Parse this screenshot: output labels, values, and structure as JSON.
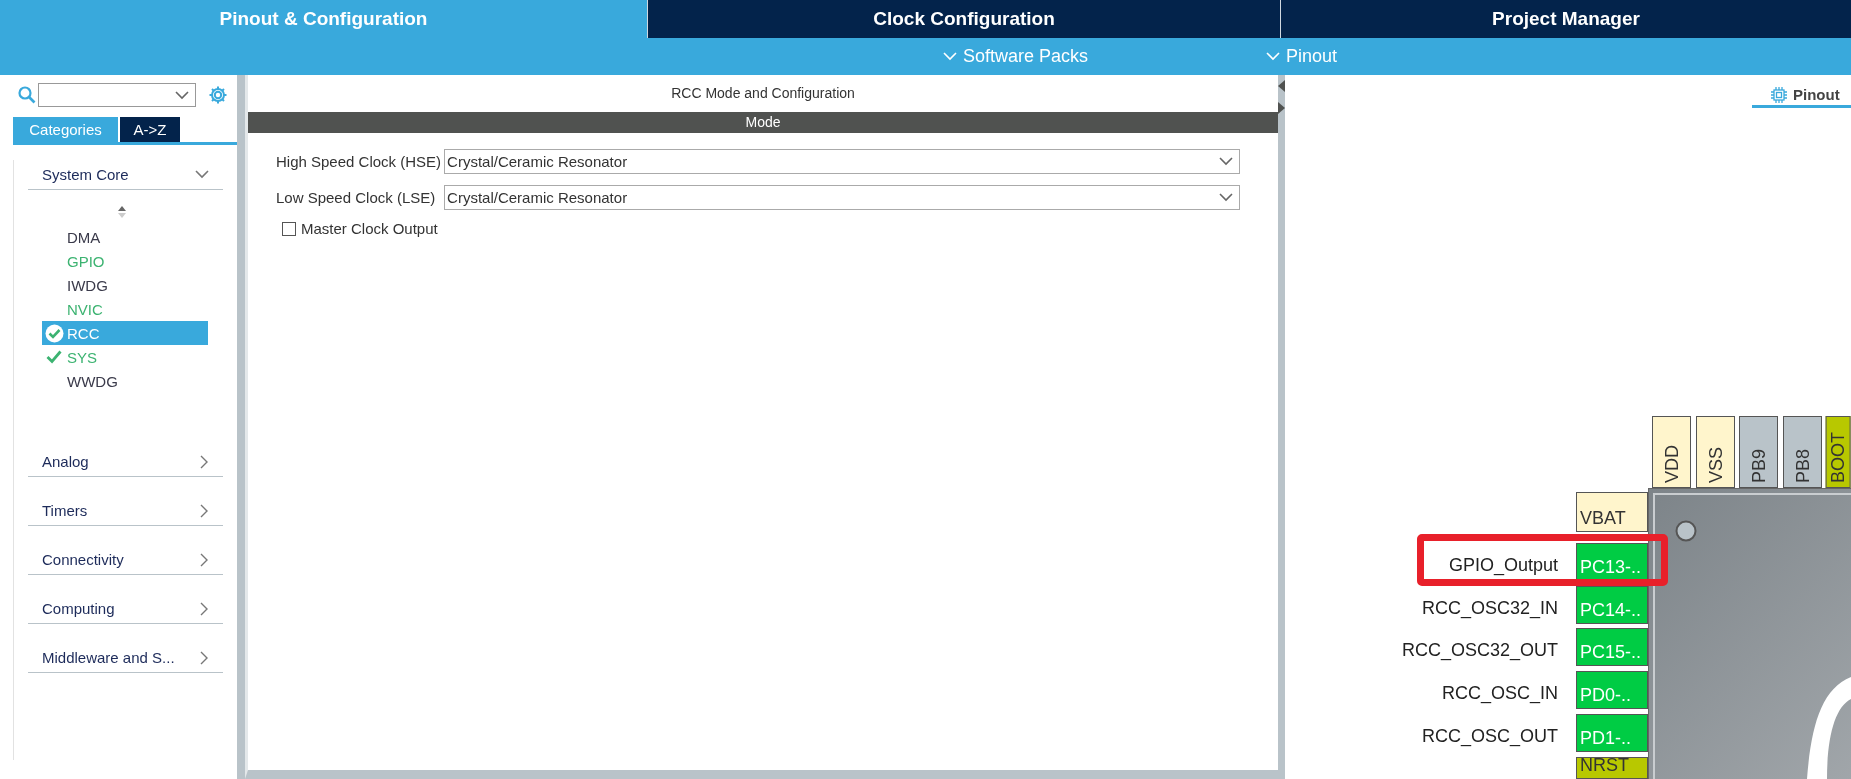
{
  "top_tabs": [
    {
      "label": "Pinout & Configuration",
      "selected": true
    },
    {
      "label": "Clock Configuration",
      "selected": false
    },
    {
      "label": "Project Manager",
      "selected": false
    }
  ],
  "sub_menu": [
    {
      "label": "Software Packs"
    },
    {
      "label": "Pinout"
    }
  ],
  "sidebar": {
    "view_tabs": [
      {
        "label": "Categories",
        "selected": true
      },
      {
        "label": "A->Z",
        "selected": false
      }
    ],
    "categories": [
      {
        "label": "System Core",
        "expanded": true,
        "items": [
          {
            "label": "DMA",
            "configured": false,
            "checked": false,
            "selected": false
          },
          {
            "label": "GPIO",
            "configured": true,
            "checked": false,
            "selected": false
          },
          {
            "label": "IWDG",
            "configured": false,
            "checked": false,
            "selected": false
          },
          {
            "label": "NVIC",
            "configured": true,
            "checked": false,
            "selected": false
          },
          {
            "label": "RCC",
            "configured": true,
            "checked": true,
            "selected": true
          },
          {
            "label": "SYS",
            "configured": true,
            "checked": true,
            "selected": false
          },
          {
            "label": "WWDG",
            "configured": false,
            "checked": false,
            "selected": false
          }
        ]
      },
      {
        "label": "Analog",
        "expanded": false
      },
      {
        "label": "Timers",
        "expanded": false
      },
      {
        "label": "Connectivity",
        "expanded": false
      },
      {
        "label": "Computing",
        "expanded": false
      },
      {
        "label": "Middleware and S...",
        "expanded": false
      }
    ]
  },
  "config_panel": {
    "title": "RCC Mode and Configuration",
    "section": "Mode",
    "fields": [
      {
        "label": "High Speed Clock (HSE)",
        "value": "Crystal/Ceramic Resonator"
      },
      {
        "label": "Low Speed Clock (LSE)",
        "value": "Crystal/Ceramic Resonator"
      }
    ],
    "options": [
      {
        "label": "Master Clock Output",
        "checked": false
      }
    ]
  },
  "pinout_view": {
    "tab": {
      "label": "Pinout",
      "selected": true
    },
    "top_pins": [
      {
        "label": "VDD",
        "kind": "power"
      },
      {
        "label": "VSS",
        "kind": "power"
      },
      {
        "label": "PB9",
        "kind": "unused"
      },
      {
        "label": "PB8",
        "kind": "unused"
      },
      {
        "label": "BOOT",
        "kind": "fixed"
      }
    ],
    "left_pins": [
      {
        "label": "VBAT",
        "kind": "power",
        "highlighted": false
      },
      {
        "label": "PC13-..",
        "kind": "assigned",
        "signal": "GPIO_Output",
        "highlighted": true
      },
      {
        "label": "PC14-..",
        "kind": "assigned",
        "signal": "RCC_OSC32_IN",
        "highlighted": false
      },
      {
        "label": "PC15-..",
        "kind": "assigned",
        "signal": "RCC_OSC32_OUT",
        "highlighted": false
      },
      {
        "label": "PD0-..",
        "kind": "assigned",
        "signal": "RCC_OSC_IN",
        "highlighted": false
      },
      {
        "label": "PD1-..",
        "kind": "assigned",
        "signal": "RCC_OSC_OUT",
        "highlighted": false
      },
      {
        "label": "NRST",
        "kind": "fixed",
        "highlighted": false
      }
    ]
  }
}
